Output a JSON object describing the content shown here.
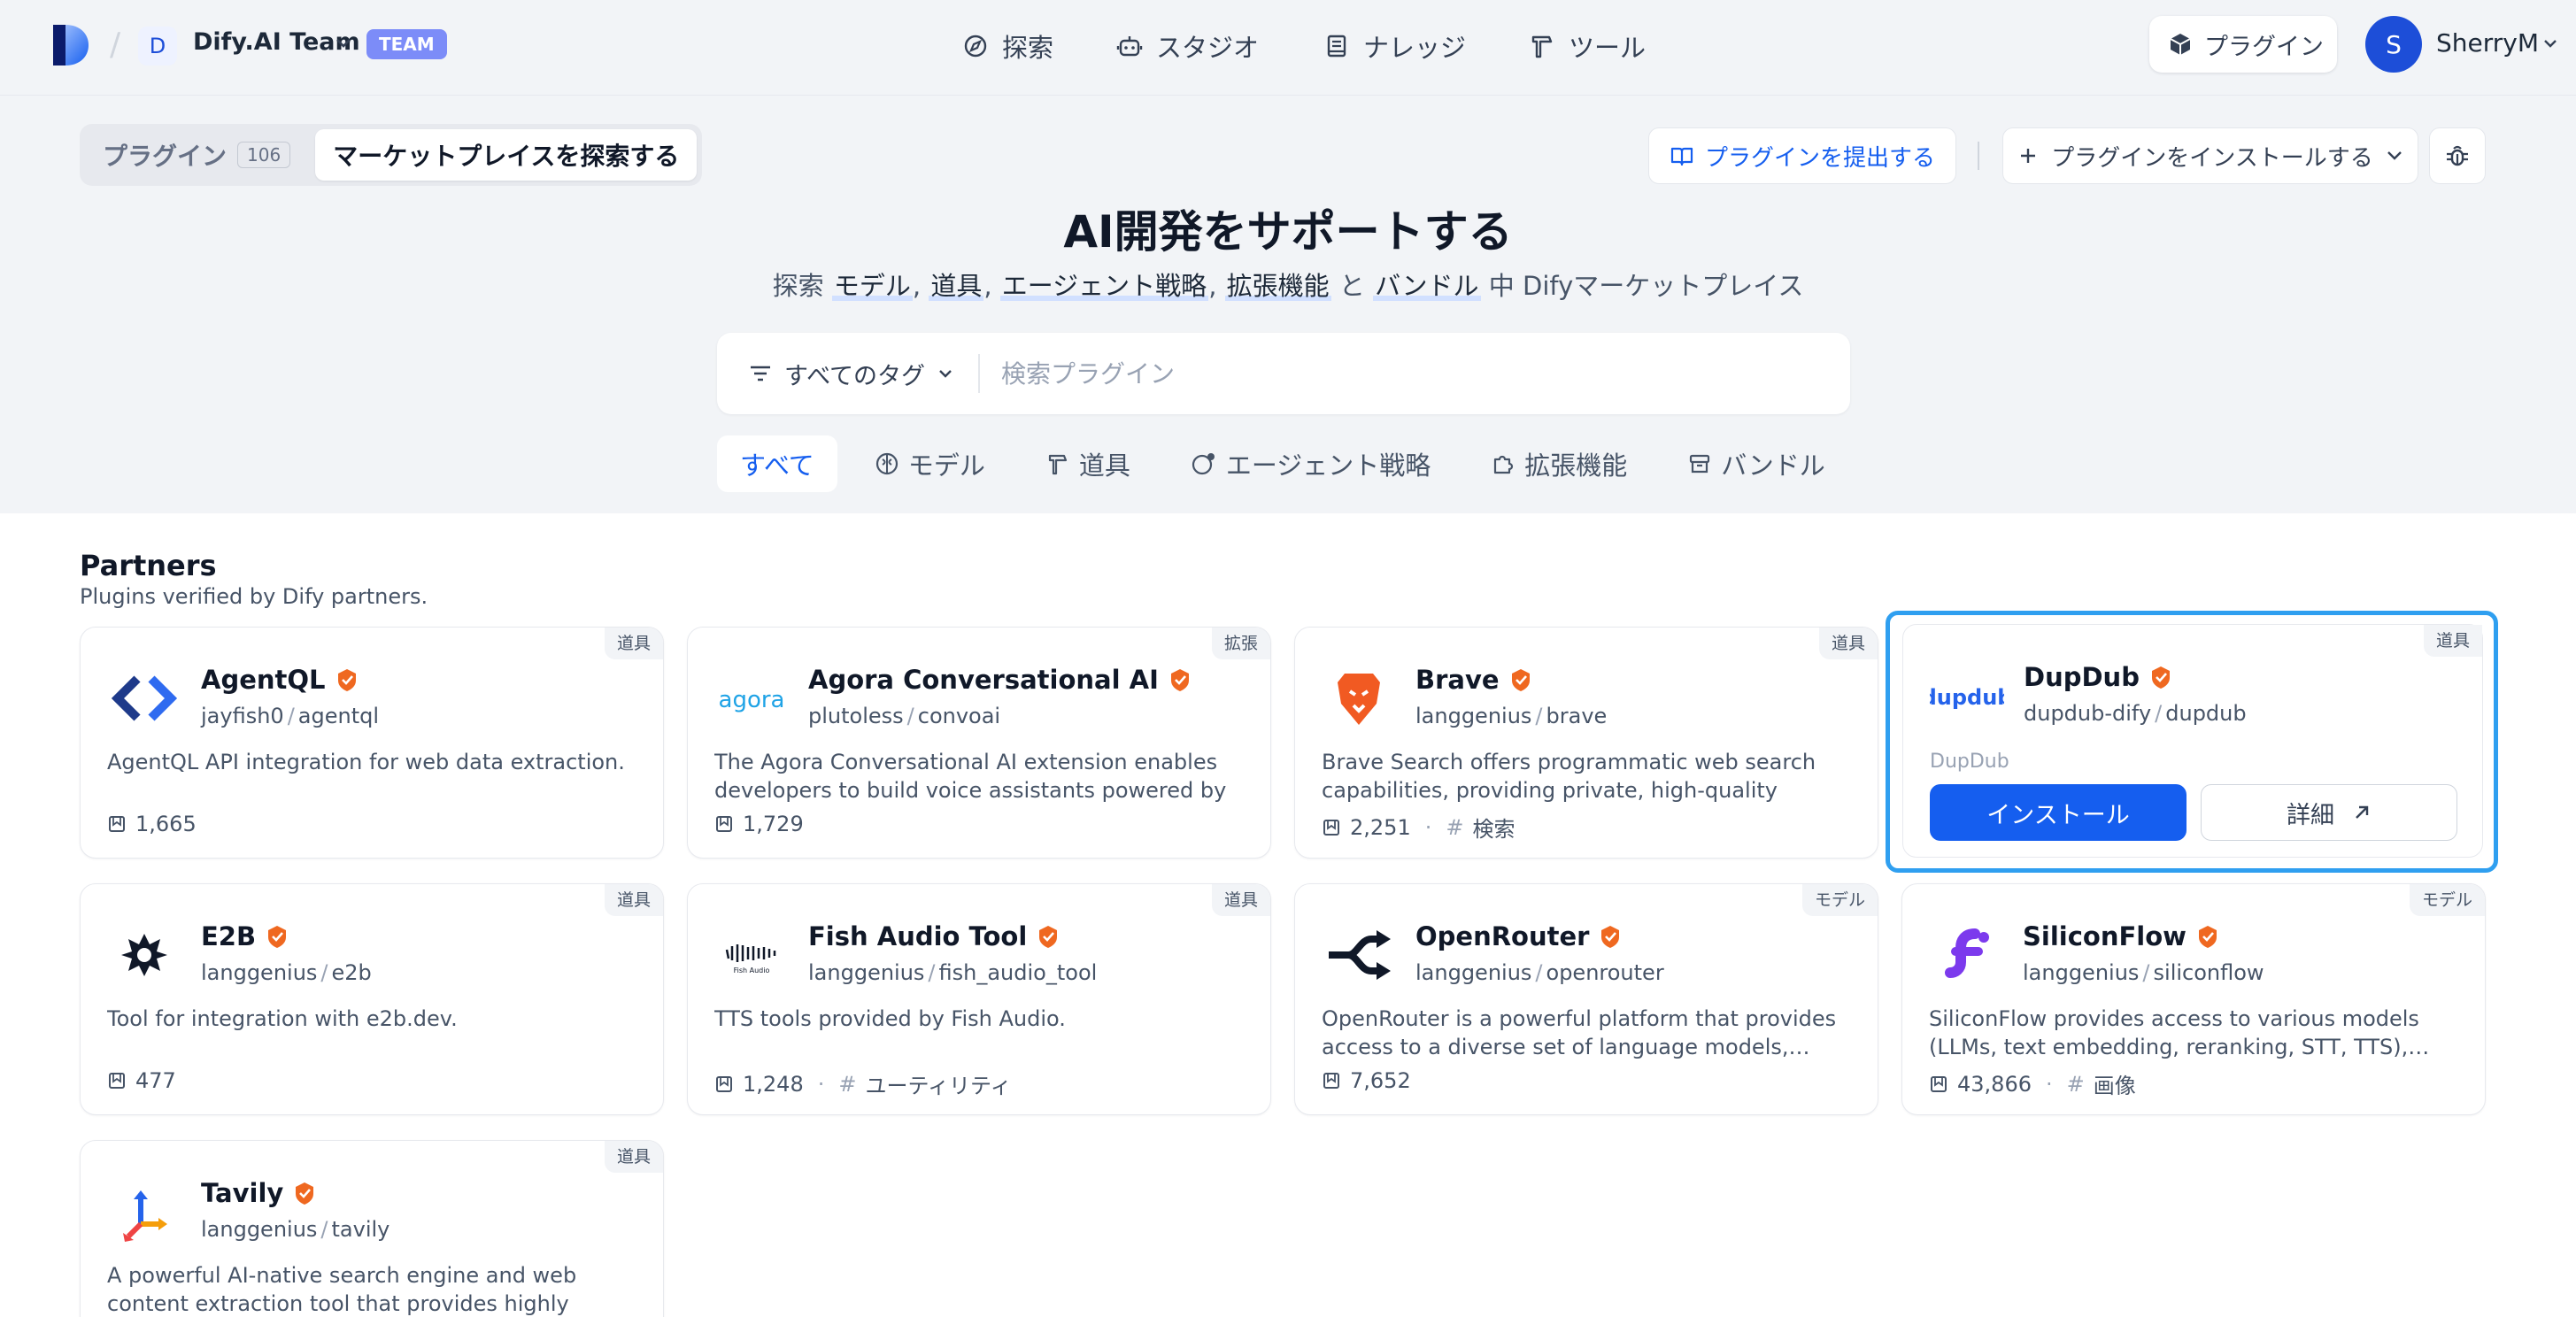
{
  "header": {
    "workspace_initial": "D",
    "workspace_name": "Dify.AI Team",
    "team_badge": "TEAM",
    "nav": [
      {
        "label": "探索",
        "icon": "compass-icon"
      },
      {
        "label": "スタジオ",
        "icon": "robot-icon"
      },
      {
        "label": "ナレッジ",
        "icon": "book-icon"
      },
      {
        "label": "ツール",
        "icon": "hammer-icon"
      }
    ],
    "plugin_button": "プラグイン",
    "user_initial": "S",
    "user_name": "SherryM"
  },
  "toolbar": {
    "tab_plugins": "プラグイン",
    "plugins_count": "106",
    "tab_marketplace": "マーケットプレイスを探索する",
    "submit_plugin": "プラグインを提出する",
    "install_plugin": "プラグインをインストールする"
  },
  "hero": {
    "title": "AI開発をサポートする",
    "sub_prefix": "探索",
    "sub_items": [
      "モデル",
      "道具",
      "エージェント戦略",
      "拡張機能"
    ],
    "sub_and": "と",
    "sub_last": "バンドル",
    "sub_suffix": "中 Difyマーケットプレイス"
  },
  "search": {
    "tag_selector": "すべてのタグ",
    "placeholder": "検索プラグイン"
  },
  "categories": [
    "すべて",
    "モデル",
    "道具",
    "エージェント戦略",
    "拡張機能",
    "バンドル"
  ],
  "partners": {
    "title": "Partners",
    "description": "Plugins verified by Dify partners.",
    "cards": [
      {
        "name": "AgentQL",
        "org": "jayfish0",
        "repo": "agentql",
        "tag": "道具",
        "desc": "AgentQL API integration for web data extraction.",
        "installs": "1,665",
        "keyword": "",
        "icon": "agentql-logo-icon"
      },
      {
        "name": "Agora Conversational AI",
        "org": "plutoless",
        "repo": "convoai",
        "tag": "拡張",
        "desc": "The Agora Conversational AI extension enables developers to build voice assistants powered by Di…",
        "installs": "1,729",
        "keyword": "",
        "icon": "agora-logo-icon"
      },
      {
        "name": "Brave",
        "org": "langgenius",
        "repo": "brave",
        "tag": "道具",
        "desc": "Brave Search offers programmatic web search capabilities, providing private, high-quality search…",
        "installs": "2,251",
        "keyword": "検索",
        "icon": "brave-logo-icon"
      },
      {
        "name": "DupDub",
        "org": "dupdub-dify",
        "repo": "dupdub",
        "tag": "道具",
        "desc": "DupDub",
        "installs": "",
        "keyword": "",
        "icon": "dupdub-logo-icon",
        "install_label": "インストール",
        "detail_label": "詳細"
      },
      {
        "name": "E2B",
        "org": "langgenius",
        "repo": "e2b",
        "tag": "道具",
        "desc": "Tool for integration with e2b.dev.",
        "installs": "477",
        "keyword": "",
        "icon": "e2b-logo-icon"
      },
      {
        "name": "Fish Audio Tool",
        "org": "langgenius",
        "repo": "fish_audio_tool",
        "tag": "道具",
        "desc": "TTS tools provided by Fish Audio.",
        "installs": "1,248",
        "keyword": "ユーティリティ",
        "icon": "fish-audio-logo-icon"
      },
      {
        "name": "OpenRouter",
        "org": "langgenius",
        "repo": "openrouter",
        "tag": "モデル",
        "desc": "OpenRouter is a powerful platform that provides access to a diverse set of language models,…",
        "installs": "7,652",
        "keyword": "",
        "icon": "openrouter-logo-icon"
      },
      {
        "name": "SiliconFlow",
        "org": "langgenius",
        "repo": "siliconflow",
        "tag": "モデル",
        "desc": "SiliconFlow provides access to various models (LLMs, text embedding, reranking, STT, TTS),…",
        "installs": "43,866",
        "keyword": "画像",
        "icon": "siliconflow-logo-icon"
      },
      {
        "name": "Tavily",
        "org": "langgenius",
        "repo": "tavily",
        "tag": "道具",
        "desc": "A powerful AI-native search engine and web content extraction tool that provides highly relevant search…",
        "installs": "",
        "keyword": "",
        "icon": "tavily-logo-icon"
      }
    ]
  },
  "colors": {
    "accent": "#155eef",
    "highlight_border": "#2f9ff0",
    "verified": "#ef6820"
  }
}
